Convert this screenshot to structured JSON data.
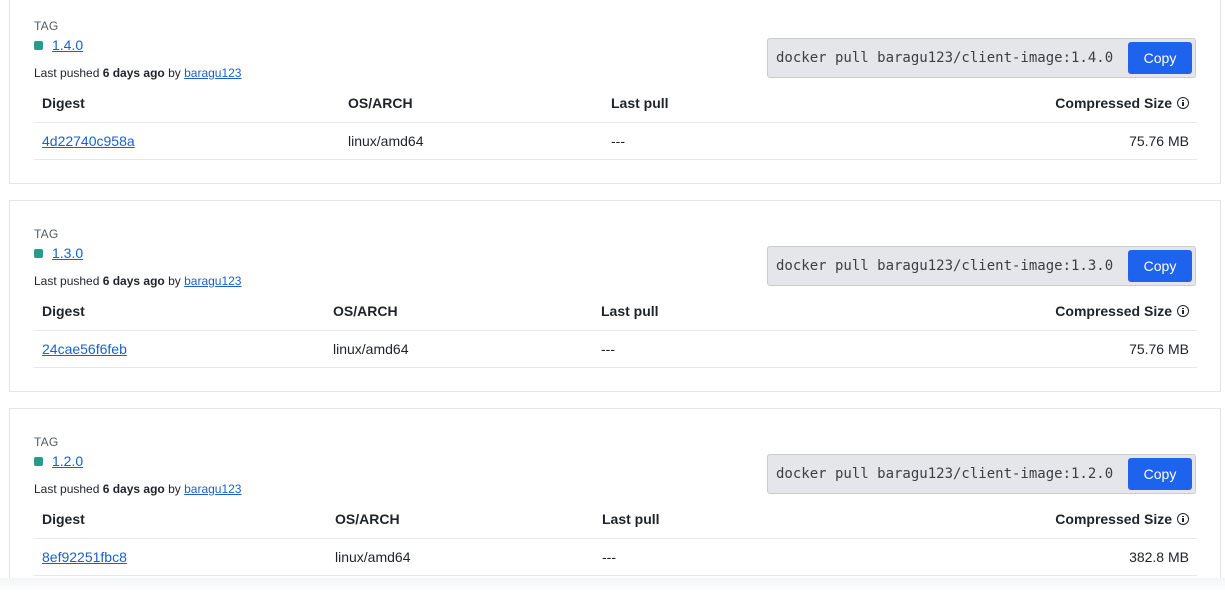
{
  "tags": [
    {
      "caption": "TAG",
      "name": "1.4.0",
      "pushed_prefix": "Last pushed ",
      "pushed_when": "6 days ago",
      "pushed_by_prefix": " by ",
      "pushed_by": "baragu123",
      "pull_command": "docker pull baragu123/client-image:1.4.0",
      "copy_label": "Copy",
      "columns": [
        "Digest",
        "OS/ARCH",
        "Last pull",
        "Compressed Size"
      ],
      "rows": [
        {
          "digest": "4d22740c958a",
          "os_arch": "linux/amd64",
          "last_pull": "---",
          "size": "75.76 MB"
        }
      ]
    },
    {
      "caption": "TAG",
      "name": "1.3.0",
      "pushed_prefix": "Last pushed ",
      "pushed_when": "6 days ago",
      "pushed_by_prefix": " by ",
      "pushed_by": "baragu123",
      "pull_command": "docker pull baragu123/client-image:1.3.0",
      "copy_label": "Copy",
      "columns": [
        "Digest",
        "OS/ARCH",
        "Last pull",
        "Compressed Size"
      ],
      "rows": [
        {
          "digest": "24cae56f6feb",
          "os_arch": "linux/amd64",
          "last_pull": "---",
          "size": "75.76 MB"
        }
      ]
    },
    {
      "caption": "TAG",
      "name": "1.2.0",
      "pushed_prefix": "Last pushed ",
      "pushed_when": "6 days ago",
      "pushed_by_prefix": " by ",
      "pushed_by": "baragu123",
      "pull_command": "docker pull baragu123/client-image:1.2.0",
      "copy_label": "Copy",
      "columns": [
        "Digest",
        "OS/ARCH",
        "Last pull",
        "Compressed Size"
      ],
      "rows": [
        {
          "digest": "8ef92251fbc8",
          "os_arch": "linux/amd64",
          "last_pull": "---",
          "size": "382.8 MB"
        }
      ]
    }
  ],
  "icons": {
    "tag_status": "status-square-icon",
    "size_info": "info-circle-icon"
  },
  "colors": {
    "link": "#1a5fd0",
    "copy_button": "#1d63ed",
    "tag_status": "#2b9a86"
  }
}
